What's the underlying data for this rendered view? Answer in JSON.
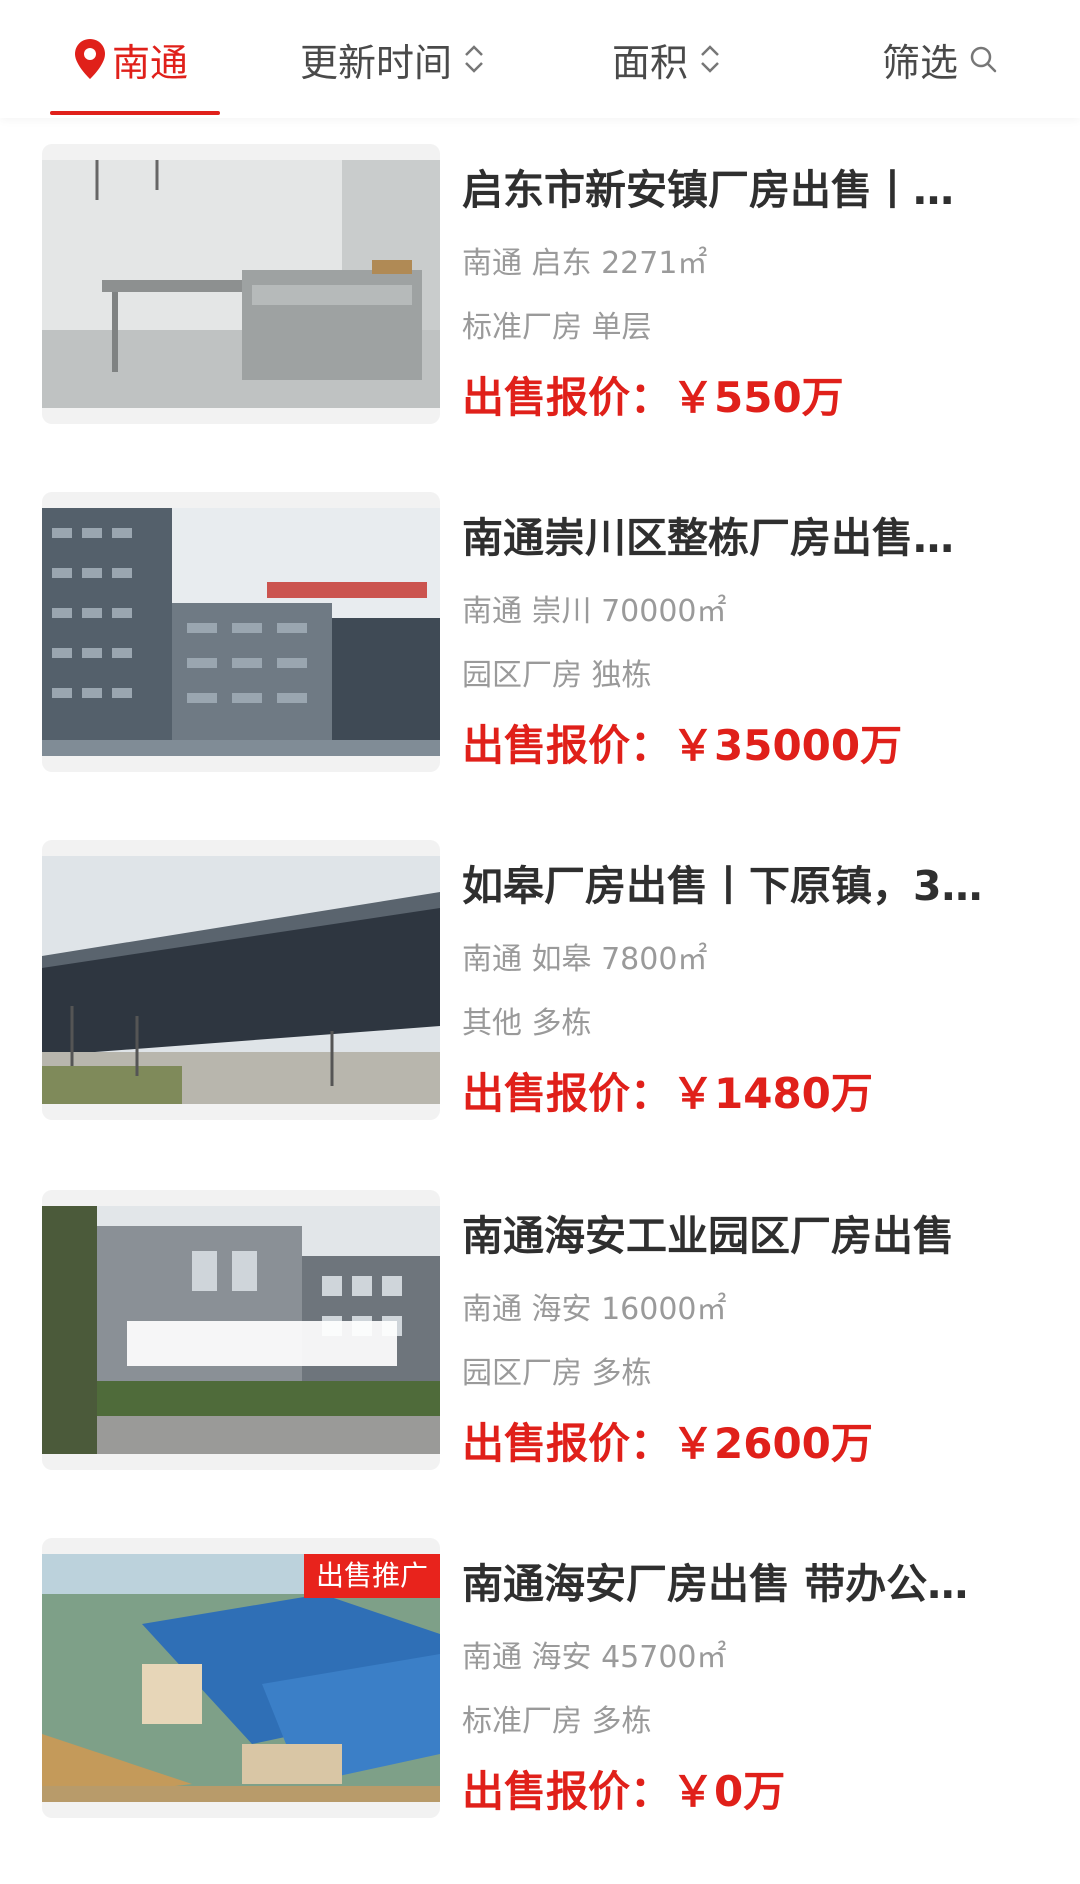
{
  "filter_bar": {
    "city": "南通",
    "sort_time": "更新时间",
    "sort_area": "面积",
    "filter": "筛选"
  },
  "colors": {
    "accent": "#e0201a",
    "title_text": "#2f2f2f",
    "meta_text": "#9a9a9a"
  },
  "listings": [
    {
      "title": "启东市新安镇厂房出售丨…",
      "meta": "南通 启东 2271㎡",
      "type": "标准厂房 单层",
      "price_label": "出售报价：",
      "price": "￥550万"
    },
    {
      "title": "南通崇川区整栋厂房出售…",
      "meta": "南通 崇川 70000㎡",
      "type": "园区厂房 独栋",
      "price_label": "出售报价：",
      "price": "￥35000万"
    },
    {
      "title": "如皋厂房出售丨下原镇，3…",
      "meta": "南通 如皋 7800㎡",
      "type": "其他 多栋",
      "price_label": "出售报价：",
      "price": "￥1480万"
    },
    {
      "title": "南通海安工业园区厂房出售",
      "meta": "南通 海安 16000㎡",
      "type": "园区厂房 多栋",
      "price_label": "出售报价：",
      "price": "￥2600万"
    },
    {
      "title": "南通海安厂房出售 带办公…",
      "meta": "南通 海安 45700㎡",
      "type": "标准厂房 多栋",
      "price_label": "出售报价：",
      "price": "￥0万",
      "badge": "出售推广"
    }
  ]
}
